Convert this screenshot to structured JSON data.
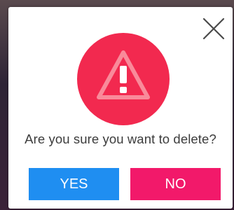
{
  "dialog": {
    "message": "Are you sure you want to delete?",
    "yes_label": "YES",
    "no_label": "NO",
    "close_icon": "close-icon",
    "alert_icon": "warning-triangle-icon"
  },
  "colors": {
    "danger_circle": "#f2294f",
    "yes_button": "#1f8ef1",
    "no_button": "#f2196a",
    "dialog_background": "#ffffff",
    "text": "#3c3c3c"
  }
}
